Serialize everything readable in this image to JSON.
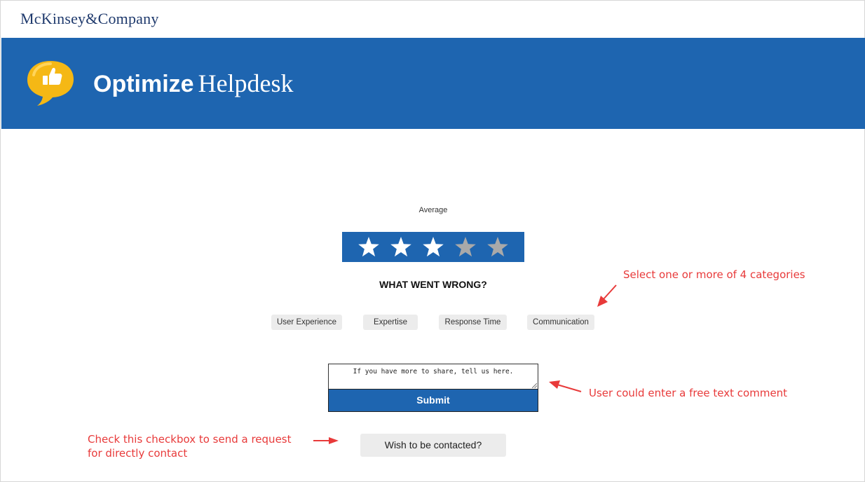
{
  "header": {
    "brand": "McKinsey&Company"
  },
  "banner": {
    "title_bold": "Optimize",
    "title_light": "Helpdesk",
    "logo_icon": "thumbs-up-speech-bubble-icon",
    "logo_color": "#f5b815",
    "background_color": "#1e65b0"
  },
  "rating": {
    "label": "Average",
    "value": 3,
    "max": 5,
    "filled_color": "#ffffff",
    "empty_color": "#a9a9a9"
  },
  "feedback": {
    "question": "WHAT WENT WRONG?",
    "categories": [
      "User Experience",
      "Expertise",
      "Response Time",
      "Communication"
    ]
  },
  "comment": {
    "placeholder": "If you have more to share, tell us here."
  },
  "submit_label": "Submit",
  "contact_label": "Wish to be contacted?",
  "annotations": {
    "categories_note": "Select one or more of 4 categories",
    "comment_note": "User could enter a free text comment",
    "contact_note": "Check this checkbox to send a request for directly contact",
    "color": "#e83a3a"
  }
}
